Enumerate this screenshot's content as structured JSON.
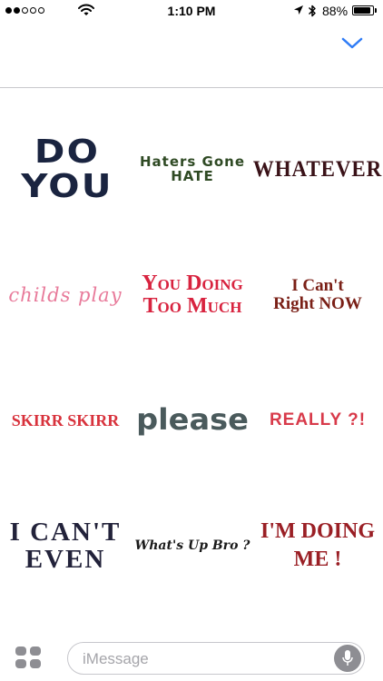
{
  "status_bar": {
    "time": "1:10 PM",
    "battery_text": "88%",
    "battery_level": 0.88,
    "signal_bars_filled": 2,
    "signal_bars_total": 5,
    "icons": [
      "wifi-icon",
      "location-icon",
      "bluetooth-icon",
      "battery-icon"
    ]
  },
  "header": {
    "collapse_icon": "chevron-down-icon",
    "accent_color": "#2f7cf6"
  },
  "stickers": [
    {
      "text": "DO\nYOU",
      "color": "#1a2440"
    },
    {
      "text": "Haters Gone\nHATE",
      "color": "#2f4a24"
    },
    {
      "text": "WHATEVER",
      "color": "#3a1218"
    },
    {
      "text": "childs play",
      "color": "#e87a9a"
    },
    {
      "text": "You Doing\nToo Much",
      "color": "#d8233f"
    },
    {
      "text": "I Can't\nRight NOW",
      "color": "#7a1f16"
    },
    {
      "text": "SKIRR SKIRR",
      "color": "#d8323c"
    },
    {
      "text": "please",
      "color": "#4a5a5c"
    },
    {
      "text": "REALLY ?!",
      "color": "#d83a4a"
    },
    {
      "text": "I CAN'T\nEVEN",
      "color": "#22223a"
    },
    {
      "text": "What's Up Bro ?",
      "color": "#1a1a1a"
    },
    {
      "text": "I'M DOING\nME !",
      "color": "#9a1f25"
    }
  ],
  "compose": {
    "placeholder": "iMessage",
    "apps_icon": "app-drawer-icon",
    "mic_icon": "microphone-icon"
  }
}
